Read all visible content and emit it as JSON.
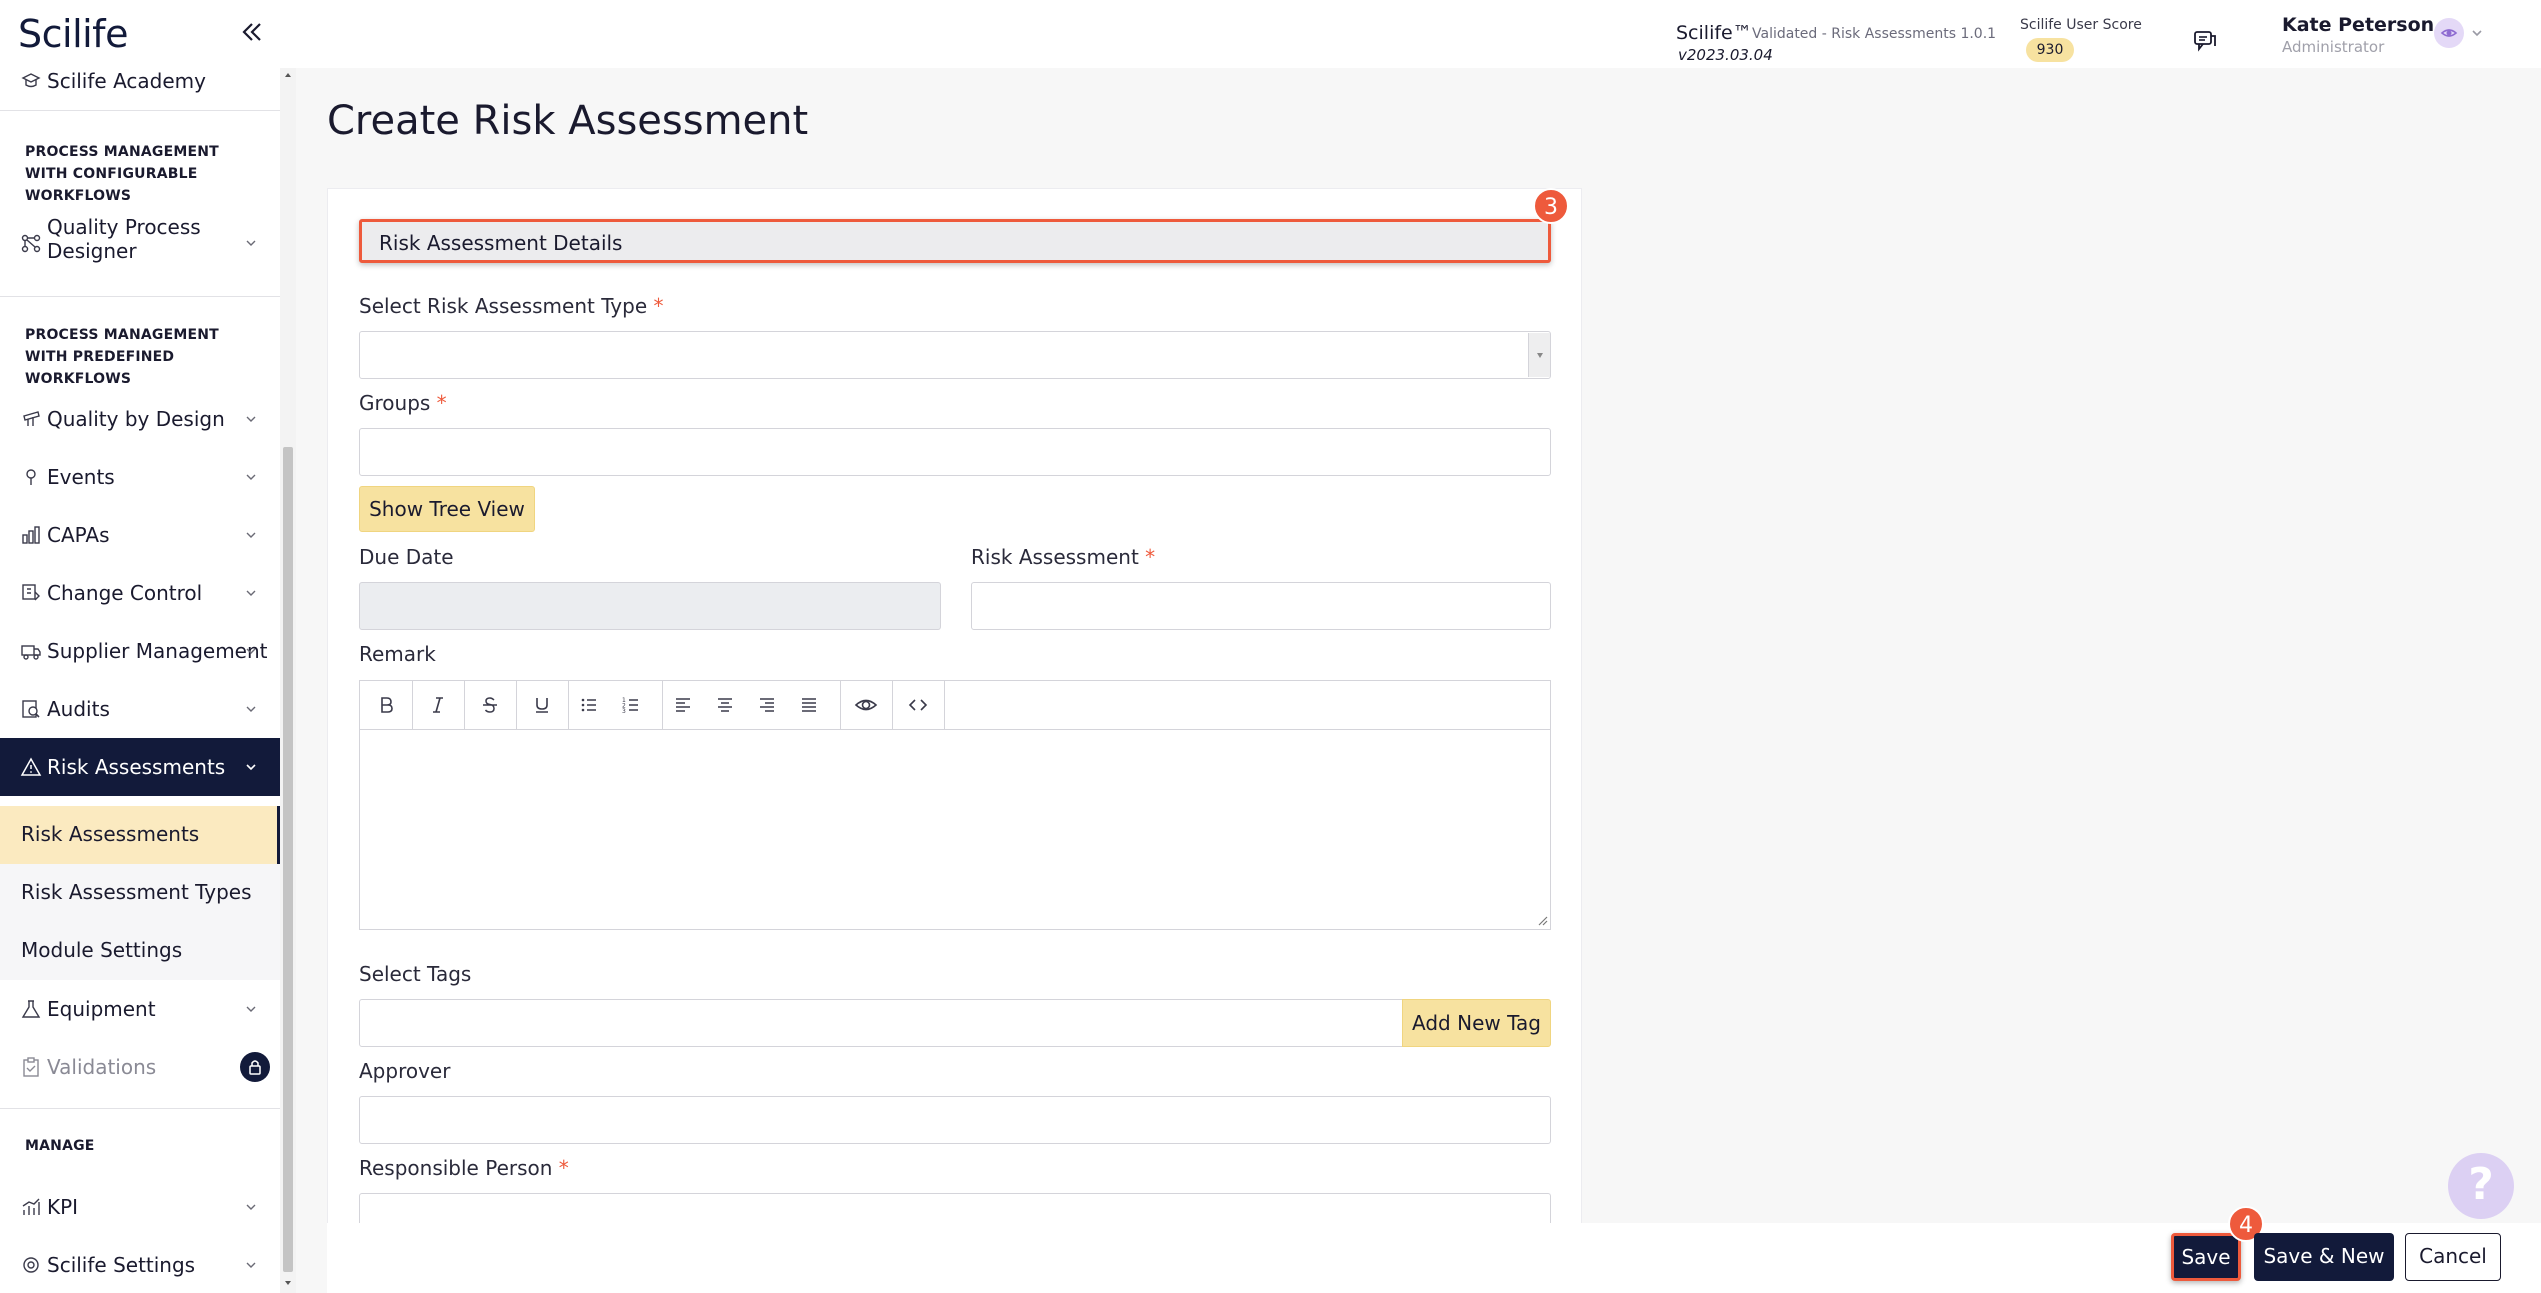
{
  "header": {
    "logo": "Scilife",
    "app_name": "Scilife™",
    "app_validated": "Validated - Risk Assessments 1.0.1",
    "app_version": "v2023.03.04",
    "score_label": "Scilife User Score",
    "score_value": "930",
    "user_name": "Kate Peterson",
    "user_role": "Administrator"
  },
  "sidebar": {
    "academy": "Scilife Academy",
    "section_configurable": "PROCESS MANAGEMENT WITH CONFIGURABLE WORKFLOWS",
    "quality_process_designer_line1": "Quality Process",
    "quality_process_designer_line2": "Designer",
    "section_predefined": "PROCESS MANAGEMENT WITH PREDEFINED WORKFLOWS",
    "items": [
      {
        "label": "Quality by Design",
        "icon": "ruler-icon"
      },
      {
        "label": "Events",
        "icon": "pin-icon"
      },
      {
        "label": "CAPAs",
        "icon": "chart-icon"
      },
      {
        "label": "Change Control",
        "icon": "change-icon"
      },
      {
        "label": "Supplier Management",
        "icon": "truck-icon"
      },
      {
        "label": "Audits",
        "icon": "audit-icon"
      },
      {
        "label": "Risk Assessments",
        "icon": "warning-icon"
      }
    ],
    "sub_items": [
      "Risk Assessments",
      "Risk Assessment Types",
      "Module Settings"
    ],
    "equipment": "Equipment",
    "validations": "Validations",
    "section_manage": "MANAGE",
    "kpi": "KPI",
    "settings": "Scilife Settings"
  },
  "main": {
    "title": "Create Risk Assessment",
    "section_header": "Risk Assessment Details",
    "step_section": "3",
    "step_save": "4",
    "fields": {
      "type_label": "Select Risk Assessment Type",
      "groups_label": "Groups",
      "tree_view_button": "Show Tree View",
      "due_date_label": "Due Date",
      "risk_assessment_label": "Risk Assessment",
      "remark_label": "Remark",
      "tags_label": "Select Tags",
      "add_tag_button": "Add New Tag",
      "approver_label": "Approver",
      "responsible_label": "Responsible Person",
      "required_marker": "*"
    }
  },
  "footer": {
    "save": "Save",
    "save_new": "Save & New",
    "cancel": "Cancel",
    "help": "?"
  },
  "colors": {
    "navy": "#121a3a",
    "accent": "#ee5a3c",
    "yellow": "#f7e2a0",
    "active_sub_bg": "#fbeac0"
  }
}
